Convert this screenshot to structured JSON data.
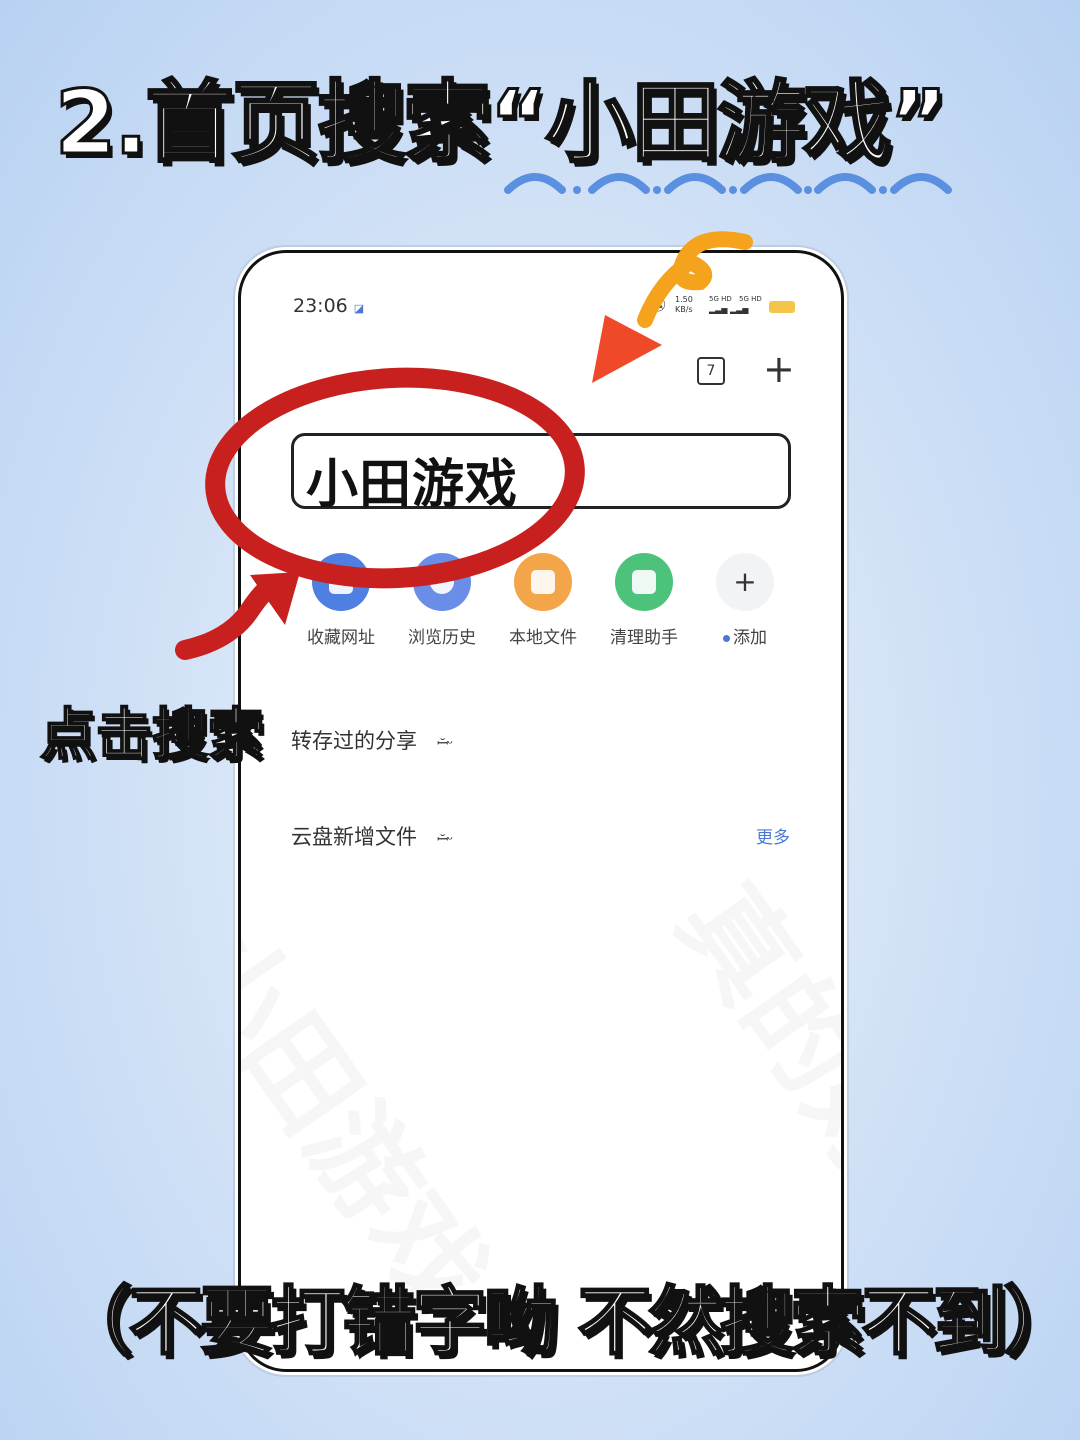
{
  "headline": "2.首页搜索“小田游戏”",
  "status_bar": {
    "time": "23:06",
    "speed_value": "1.50",
    "speed_unit": "KB/s",
    "signal_1": "5G HD",
    "signal_2": "5G HD"
  },
  "toolbar": {
    "tab_count": "7",
    "add_symbol": "+"
  },
  "search": {
    "query": "小田游戏"
  },
  "shortcuts": [
    {
      "label": "收藏网址",
      "icon": "star-folder-icon",
      "color": "#4f7fe0"
    },
    {
      "label": "浏览历史",
      "icon": "clock-icon",
      "color": "#6a8de8"
    },
    {
      "label": "本地文件",
      "icon": "folder-icon",
      "color": "#f3a54a"
    },
    {
      "label": "清理助手",
      "icon": "broom-icon",
      "color": "#4cc27a"
    },
    {
      "label": "添加",
      "icon": "plus-icon",
      "color": "#f2f3f5"
    }
  ],
  "sections": {
    "saved_shares": "转存过的分享",
    "cloud_new": "云盘新增文件",
    "more": "更多"
  },
  "callout": "点击搜索",
  "bottom_note": "（不要打错字呦  不然搜索不到）",
  "watermarks": [
    "小田游戏",
    "真的好玩"
  ],
  "colors": {
    "annotation_red": "#c8201e",
    "arrow_orange": "#f5a21c",
    "accent_blue": "#4a78d6"
  }
}
